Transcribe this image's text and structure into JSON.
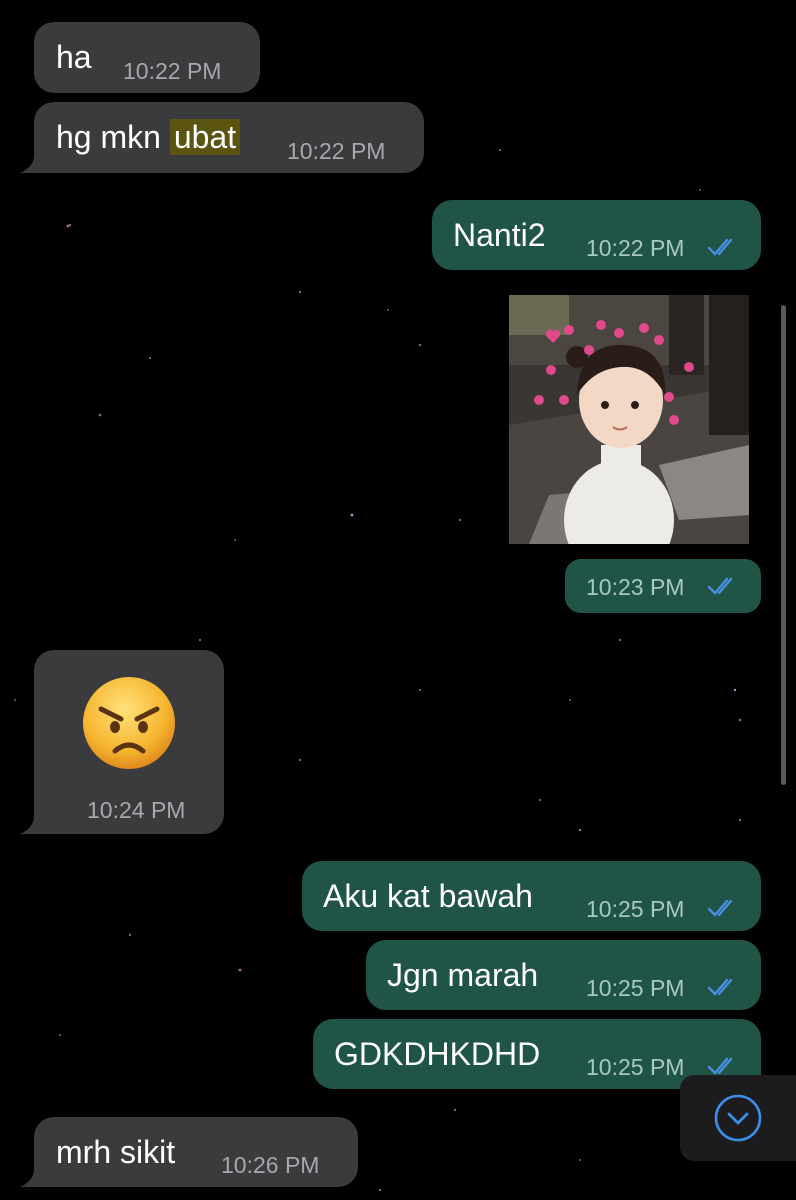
{
  "colors": {
    "background": "#000000",
    "incoming_bubble": "#3b3b3d",
    "outgoing_bubble": "#1f5447",
    "highlight": "#5b5411",
    "read_ticks": "#4a90e2"
  },
  "messages": [
    {
      "direction": "incoming",
      "text": "ha",
      "time": "10:22 PM"
    },
    {
      "direction": "incoming",
      "text_before": "hg mkn",
      "highlight": "ubat",
      "time": "10:22 PM"
    },
    {
      "direction": "outgoing",
      "text": "Nanti2",
      "time": "10:22 PM",
      "status": "read"
    },
    {
      "direction": "outgoing",
      "type": "image",
      "time": "10:23 PM",
      "status": "read"
    },
    {
      "direction": "incoming",
      "type": "emoji",
      "emoji": "😠",
      "time": "10:24 PM"
    },
    {
      "direction": "outgoing",
      "text": "Aku kat bawah",
      "time": "10:25 PM",
      "status": "read"
    },
    {
      "direction": "outgoing",
      "text": "Jgn marah",
      "time": "10:25 PM",
      "status": "read"
    },
    {
      "direction": "outgoing",
      "text": "GDKDHKDHD",
      "time": "10:25 PM",
      "status": "read"
    },
    {
      "direction": "incoming",
      "text": "mrh sikit",
      "time": "10:26 PM"
    }
  ],
  "icons": {
    "read_receipt": "double-check-icon",
    "scroll_down": "chevron-down-circle-icon"
  }
}
